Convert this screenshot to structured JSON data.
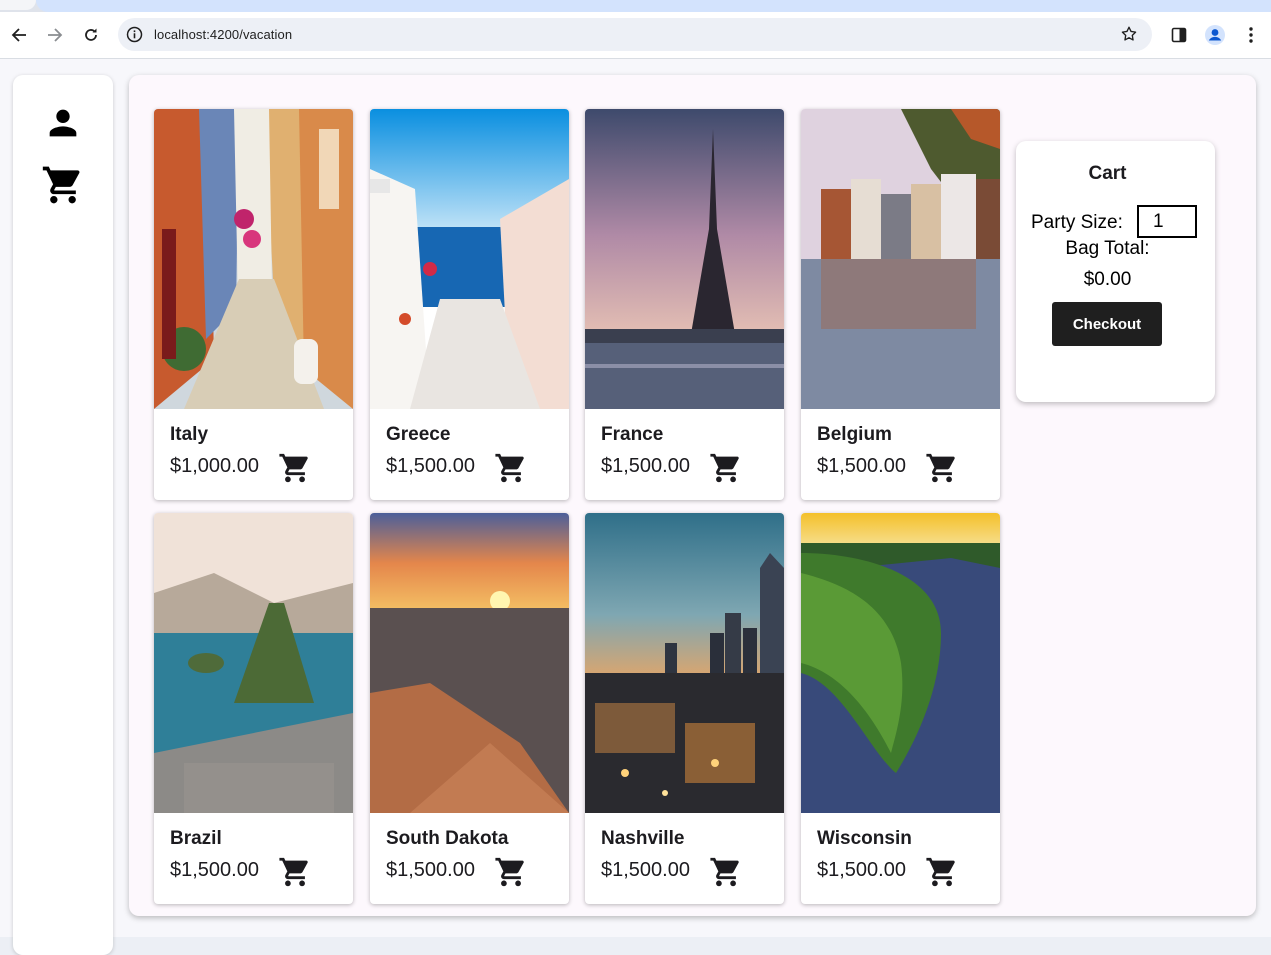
{
  "browser": {
    "url": "localhost:4200/vacation",
    "icons": [
      "back-arrow-icon",
      "forward-arrow-icon",
      "reload-icon",
      "info-icon",
      "bookmark-star-icon",
      "side-panel-icon",
      "profile-icon",
      "more-menu-icon"
    ]
  },
  "sidebar": {
    "icons": [
      "person-icon",
      "shopping-cart-icon"
    ]
  },
  "vacations": [
    {
      "name": "Italy",
      "price": "$1,000.00"
    },
    {
      "name": "Greece",
      "price": "$1,500.00"
    },
    {
      "name": "France",
      "price": "$1,500.00"
    },
    {
      "name": "Belgium",
      "price": "$1,500.00"
    },
    {
      "name": "Brazil",
      "price": "$1,500.00"
    },
    {
      "name": "South Dakota",
      "price": "$1,500.00"
    },
    {
      "name": "Nashville",
      "price": "$1,500.00"
    },
    {
      "name": "Wisconsin",
      "price": "$1,500.00"
    }
  ],
  "cart": {
    "title": "Cart",
    "party_size_label": "Party Size:",
    "party_size_value": "1",
    "bag_total_label": "Bag Total:",
    "bag_total_value": "$0.00",
    "checkout_label": "Checkout"
  },
  "colors": {
    "checkout_button": "#1f1f1f",
    "content_background": "#fdf8fd",
    "omnibox": "#edf0f6"
  }
}
